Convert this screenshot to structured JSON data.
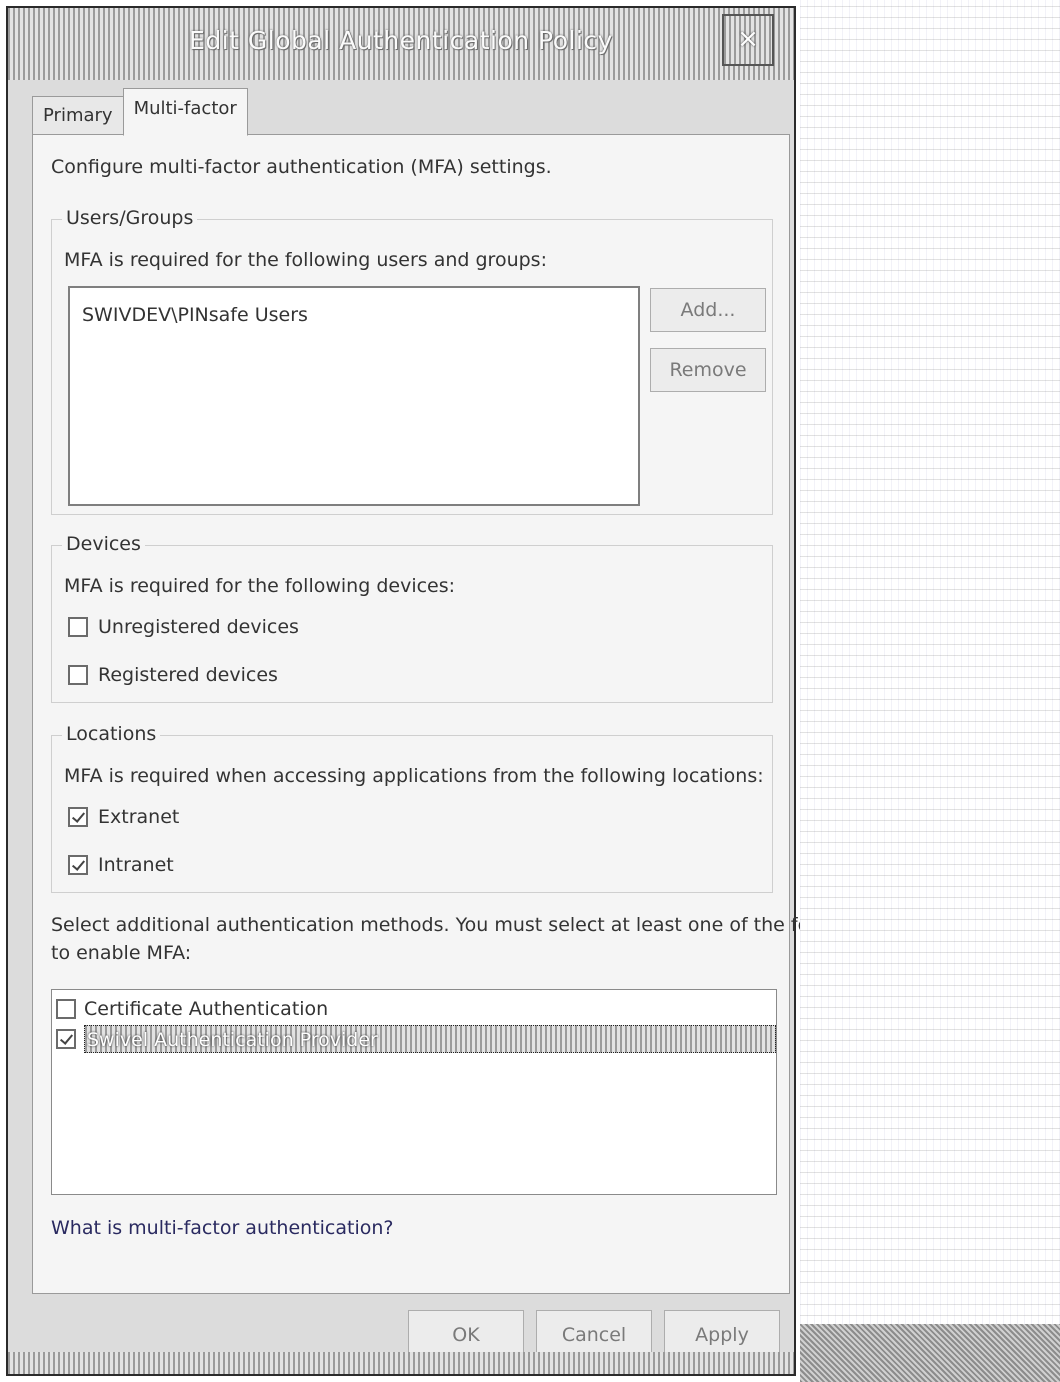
{
  "window": {
    "title": "Edit Global Authentication Policy",
    "close_glyph": "×"
  },
  "tabs": [
    {
      "label": "Primary",
      "active": false
    },
    {
      "label": "Multi-factor",
      "active": true
    }
  ],
  "intro_text": "Configure multi-factor authentication (MFA) settings.",
  "users_groups": {
    "legend": "Users/Groups",
    "description": "MFA is required for the following users and groups:",
    "items": [
      "SWIVDEV\\PINsafe Users"
    ],
    "add_label": "Add...",
    "remove_label": "Remove"
  },
  "devices": {
    "legend": "Devices",
    "description": "MFA is required for the following devices:",
    "options": [
      {
        "label": "Unregistered devices",
        "checked": false
      },
      {
        "label": "Registered devices",
        "checked": false
      }
    ]
  },
  "locations": {
    "legend": "Locations",
    "description": "MFA is required when accessing applications from the following locations:",
    "options": [
      {
        "label": "Extranet",
        "checked": true
      },
      {
        "label": "Intranet",
        "checked": true
      }
    ]
  },
  "methods": {
    "description_line1": "Select additional authentication methods. You must select at least one of the following methods",
    "description_line2": "to enable MFA:",
    "items": [
      {
        "label": "Certificate Authentication",
        "checked": false,
        "selected": false
      },
      {
        "label": "Swivel Authentication Provider",
        "checked": true,
        "selected": true
      }
    ]
  },
  "help_link": "What is multi-factor authentication?",
  "footer": {
    "ok_label": "OK",
    "cancel_label": "Cancel",
    "apply_label": "Apply"
  }
}
